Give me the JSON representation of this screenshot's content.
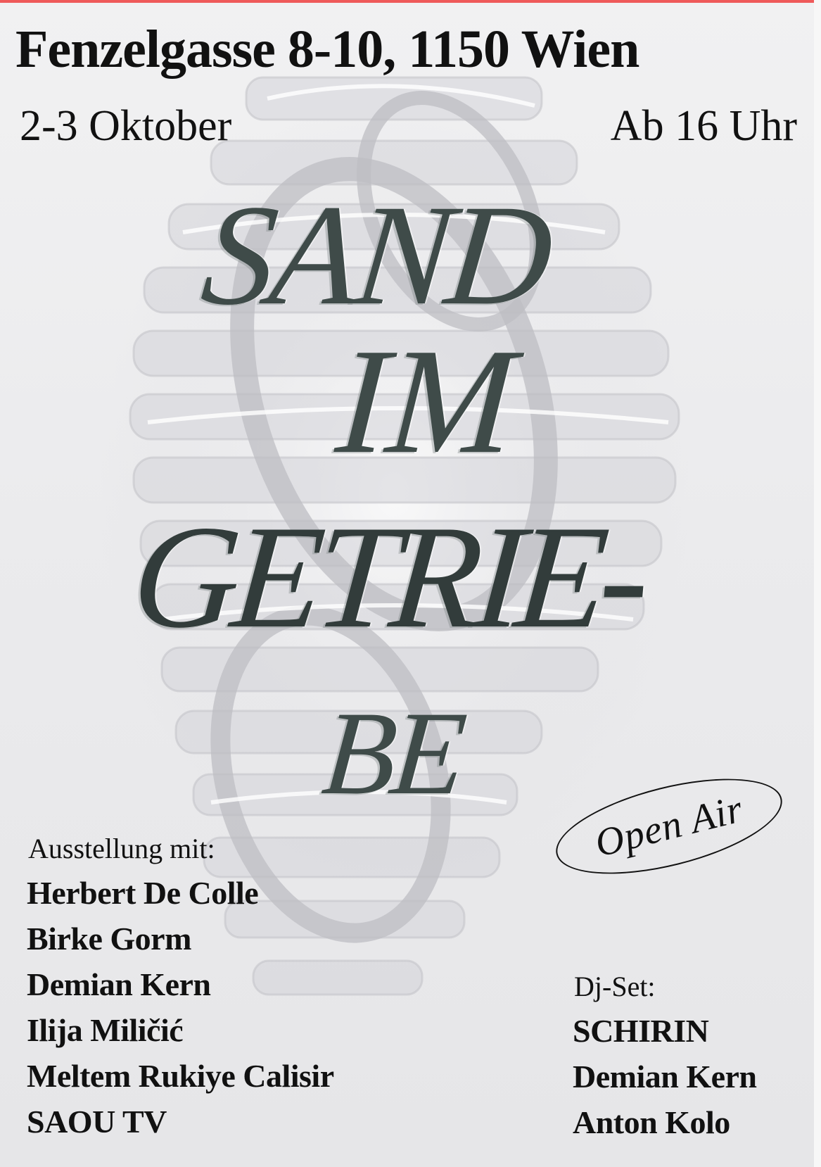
{
  "header": {
    "address": "Fenzelgasse 8-10, 1150 Wien",
    "date": "2-3 Oktober",
    "time": "Ab 16 Uhr"
  },
  "title": {
    "lines": [
      "SAND",
      "IM",
      "GETRIE-",
      "BE"
    ]
  },
  "badge": {
    "label": "Open Air"
  },
  "exhibition": {
    "heading": "Ausstellung mit:",
    "artists": [
      "Herbert De Colle",
      "Birke Gorm",
      "Demian Kern",
      "Ilija Miličić",
      "Meltem Rukiye Calisir",
      "SAOU TV"
    ]
  },
  "dj": {
    "heading": "Dj-Set:",
    "artists": [
      "SCHIRIN",
      "Demian Kern",
      "Anton Kolo"
    ]
  },
  "colors": {
    "accent_top_rule": "#ef5a5a",
    "title_ink": "#3f4b49",
    "text": "#111111",
    "background": "#ebebed"
  },
  "icons": {
    "background_art": "translucent-gear-sculpture"
  }
}
